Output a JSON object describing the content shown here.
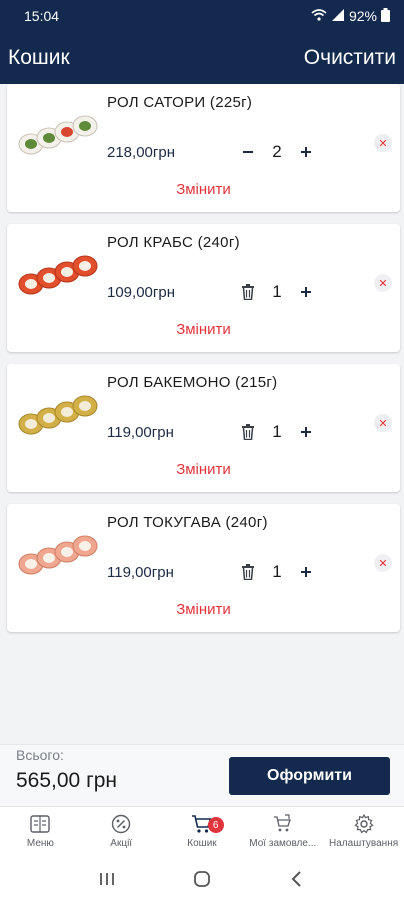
{
  "status_bar": {
    "time": "15:04",
    "battery": "92%"
  },
  "app_bar": {
    "title": "Кошик",
    "clear_label": "Очистити"
  },
  "cart_items": [
    {
      "name": "РОЛ САТОРИ (225г)",
      "price": "218,00грн",
      "quantity": "2",
      "left_action": "minus",
      "change_label": "Змінити",
      "roll_fill": "#5f8a3a"
    },
    {
      "name": "РОЛ КРАБС (240г)",
      "price": "109,00грн",
      "quantity": "1",
      "left_action": "trash",
      "change_label": "Змінити",
      "roll_fill": "#e14f2c"
    },
    {
      "name": "РОЛ БАКЕМОНО (215г)",
      "price": "119,00грн",
      "quantity": "1",
      "left_action": "trash",
      "change_label": "Змінити",
      "roll_fill": "#d3b047"
    },
    {
      "name": "РОЛ ТОКУГАВА (240г)",
      "price": "119,00грн",
      "quantity": "1",
      "left_action": "trash",
      "change_label": "Змінити",
      "roll_fill": "#f0a68f"
    }
  ],
  "totals": {
    "label": "Всього:",
    "value": "565,00 грн",
    "checkout_label": "Оформити"
  },
  "bottom_nav": {
    "items": [
      {
        "label": "Меню",
        "icon": "menu-icon"
      },
      {
        "label": "Акції",
        "icon": "percent-icon"
      },
      {
        "label": "Кошик",
        "icon": "cart-icon",
        "badge": "6"
      },
      {
        "label": "Мої замовле...",
        "icon": "orders-icon"
      },
      {
        "label": "Налаштування",
        "icon": "gear-icon"
      }
    ]
  },
  "colors": {
    "primary": "#132a4e",
    "accent": "#e0353b"
  }
}
